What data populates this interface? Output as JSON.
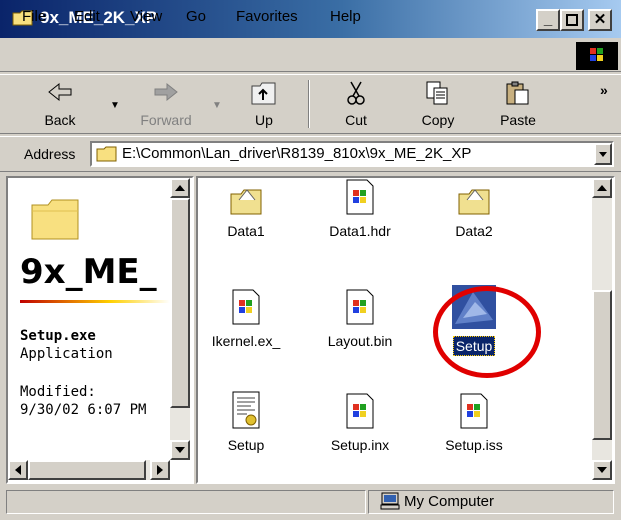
{
  "window": {
    "title": "9x_ME_2K_XP",
    "title_folder_icon": "folder-icon",
    "caption_buttons": [
      "minimize",
      "maximize",
      "close"
    ]
  },
  "menu": {
    "items": [
      {
        "label": "File",
        "underline": "F"
      },
      {
        "label": "Edit",
        "underline": "E"
      },
      {
        "label": "View",
        "underline": "V"
      },
      {
        "label": "Go",
        "underline": "G"
      },
      {
        "label": "Favorites",
        "underline": "a"
      },
      {
        "label": "Help",
        "underline": "H"
      }
    ],
    "logo_icon": "windows-logo-icon"
  },
  "toolbar": {
    "back": {
      "label": "Back",
      "icon": "arrow-left-icon"
    },
    "forward": {
      "label": "Forward",
      "icon": "arrow-right-icon",
      "enabled": false
    },
    "up": {
      "label": "Up",
      "icon": "folder-up-icon"
    },
    "cut": {
      "label": "Cut",
      "icon": "scissors-icon"
    },
    "copy": {
      "label": "Copy",
      "icon": "copy-icon"
    },
    "paste": {
      "label": "Paste",
      "icon": "paste-icon"
    },
    "more": "»"
  },
  "address": {
    "label": "Address",
    "value": "E:\\Common\\Lan_driver\\R8139_810x\\9x_ME_2K_XP"
  },
  "left_pane": {
    "folder_title": "9x_ME_",
    "file_name": "Setup.exe",
    "file_type": "Application",
    "modified_label": "Modified:",
    "modified_date": "9/30/02 6:07 PM"
  },
  "files": [
    {
      "name": "Data1",
      "icon": "folder-icon"
    },
    {
      "name": "Data1.hdr",
      "icon": "windows-file-icon"
    },
    {
      "name": "Data2",
      "icon": "folder-icon"
    },
    {
      "name": "Ikernel.ex_",
      "icon": "windows-file-icon"
    },
    {
      "name": "Layout.bin",
      "icon": "windows-file-icon"
    },
    {
      "name": "Setup",
      "icon": "setup-app-icon",
      "selected": true
    },
    {
      "name": "Setup",
      "icon": "settings-file-icon"
    },
    {
      "name": "Setup.inx",
      "icon": "windows-file-icon"
    },
    {
      "name": "Setup.iss",
      "icon": "windows-file-icon"
    }
  ],
  "status": {
    "zone_icon": "my-computer-icon",
    "zone": "My Computer"
  },
  "colors": {
    "title_gradient_start": "#0a246a",
    "title_gradient_end": "#a6caf0",
    "selection": "#0a246a",
    "highlight_circle": "#e00000"
  }
}
